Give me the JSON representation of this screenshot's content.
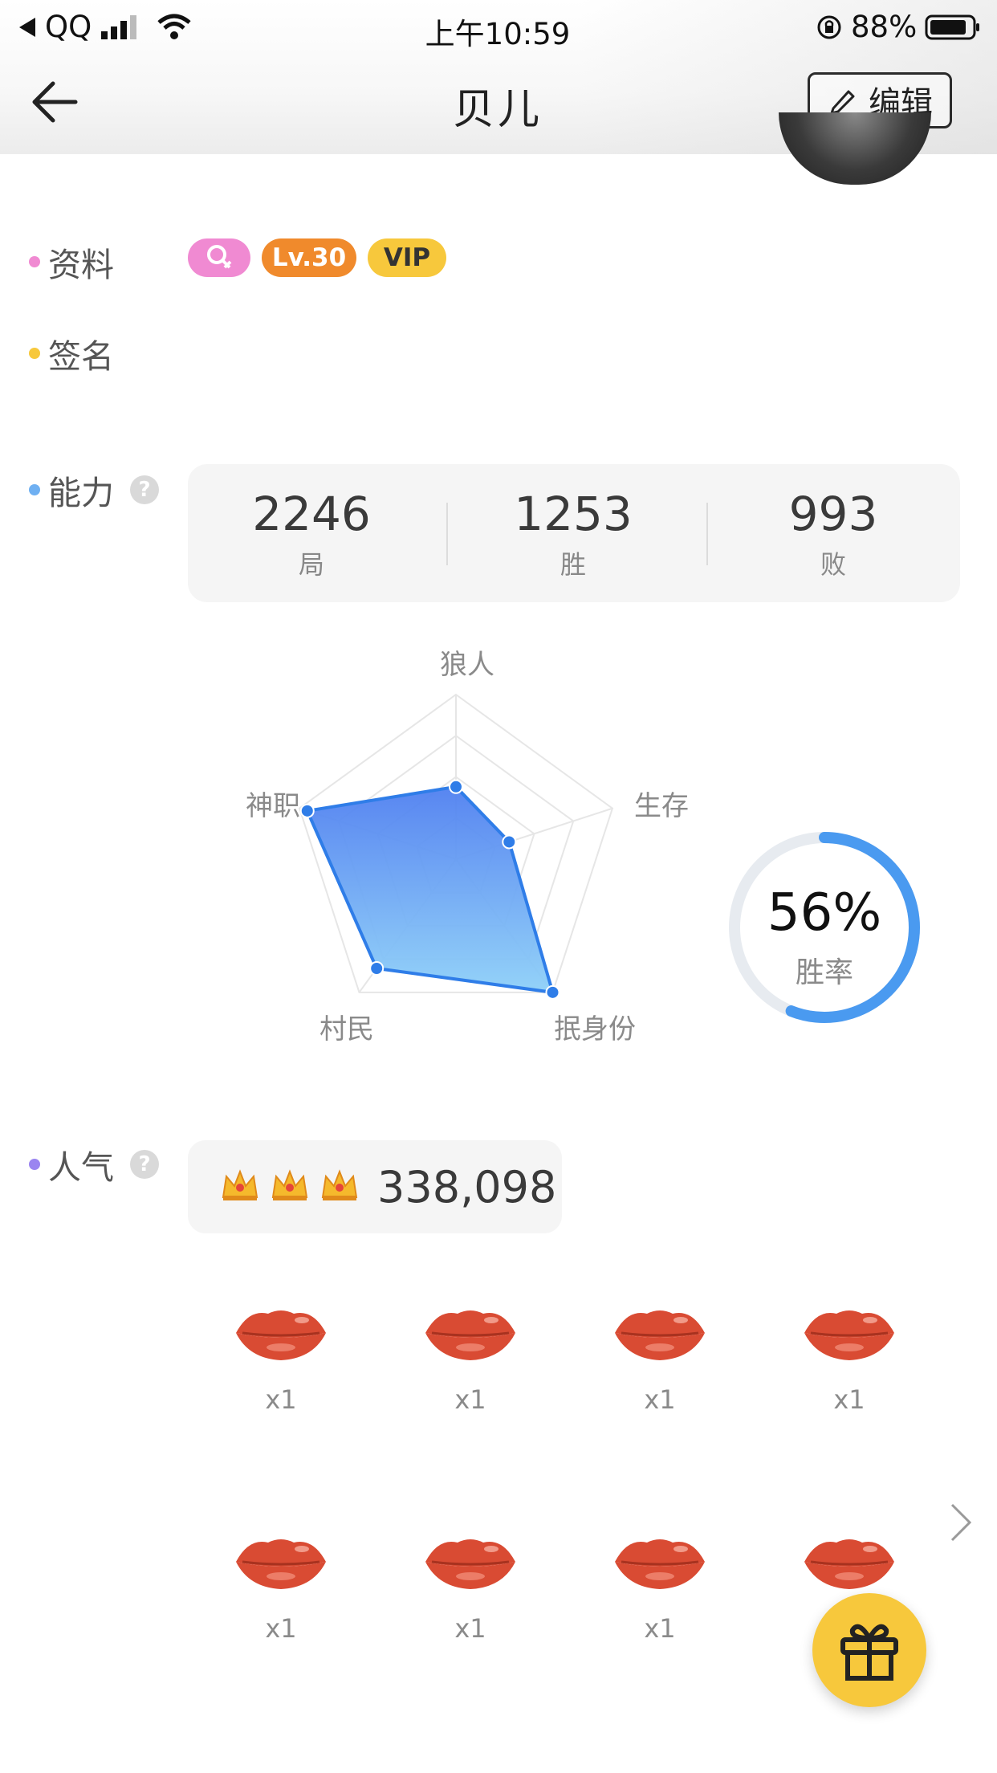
{
  "status_bar": {
    "back_app": "QQ",
    "time": "上午10:59",
    "battery": "88%"
  },
  "nav": {
    "title": "贝儿",
    "edit_label": "编辑"
  },
  "profile": {
    "label": "资料",
    "badges": [
      {
        "text": "",
        "icon": "female-icon",
        "color": "#f08ad2"
      },
      {
        "text": "Lv.30",
        "color": "#f08a2c"
      },
      {
        "text": "VIP",
        "color": "#f7c83c"
      }
    ]
  },
  "signature": {
    "label": "签名",
    "text": ""
  },
  "ability": {
    "label": "能力",
    "help": "?",
    "stats": [
      {
        "value": "2246",
        "label": "局"
      },
      {
        "value": "1253",
        "label": "胜"
      },
      {
        "value": "993",
        "label": "败"
      }
    ],
    "radar_labels": [
      "狼人",
      "生存",
      "抿身份",
      "村民",
      "神职"
    ],
    "radar_values": [
      0.44,
      0.34,
      1.0,
      0.82,
      0.95
    ],
    "winrate": {
      "value": "56%",
      "label": "胜率",
      "fraction": 0.56
    }
  },
  "popularity": {
    "label": "人气",
    "help": "?",
    "value": "338,098",
    "crowns": 3
  },
  "gifts": {
    "items": [
      {
        "icon": "lips-icon",
        "count": "x1"
      },
      {
        "icon": "lips-icon",
        "count": "x1"
      },
      {
        "icon": "lips-icon",
        "count": "x1"
      },
      {
        "icon": "lips-icon",
        "count": "x1"
      },
      {
        "icon": "lips-icon",
        "count": "x1"
      },
      {
        "icon": "lips-icon",
        "count": "x1"
      },
      {
        "icon": "lips-icon",
        "count": "x1"
      },
      {
        "icon": "lips-icon",
        "count": ""
      }
    ]
  },
  "colors": {
    "accent_blue": "#4a8ff0",
    "gift_fab": "#f7c83c",
    "lips": "#d94b33"
  }
}
